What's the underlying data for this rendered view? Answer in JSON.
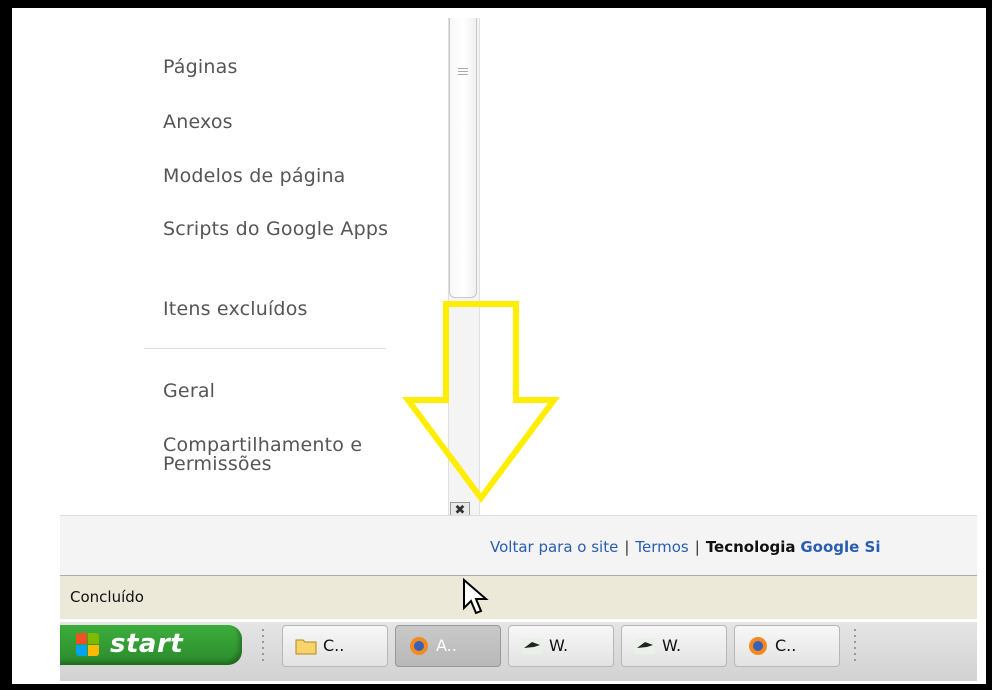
{
  "sidebar": {
    "items": [
      {
        "label": "Páginas"
      },
      {
        "label": "Anexos"
      },
      {
        "label": "Modelos de página"
      },
      {
        "label": "Scripts do Google Apps"
      },
      {
        "label": "Itens excluídos"
      }
    ],
    "settings_items": [
      {
        "label": "Geral"
      },
      {
        "label": "Compartilhamento e Permissões"
      }
    ]
  },
  "footer": {
    "back_link": "Voltar para o site",
    "separator": "|",
    "terms_link": "Termos",
    "powered_prefix": "Tecnologia",
    "powered_link": "Google Si"
  },
  "status": {
    "text": "Concluído"
  },
  "taskbar": {
    "start_label": "start",
    "buttons": [
      {
        "label": "C..",
        "icon": "folder-icon"
      },
      {
        "label": "A..",
        "icon": "firefox-icon",
        "active": true
      },
      {
        "label": "W.",
        "icon": "app-icon"
      },
      {
        "label": "W.",
        "icon": "app-icon"
      },
      {
        "label": "C..",
        "icon": "firefox-icon"
      }
    ]
  },
  "annotation": {
    "arrow_color": "#ffee00"
  }
}
